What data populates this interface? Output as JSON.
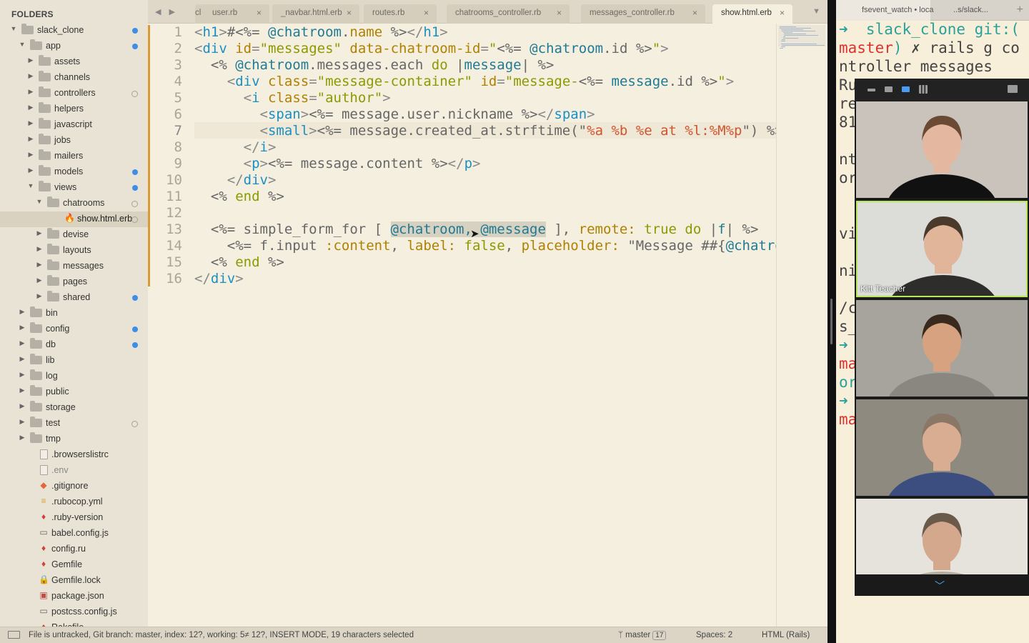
{
  "sidebar": {
    "title": "FOLDERS",
    "items": [
      {
        "label": "slack_clone",
        "type": "folder",
        "open": true,
        "depth": 0,
        "dot": "blue"
      },
      {
        "label": "app",
        "type": "folder",
        "open": true,
        "depth": 1,
        "dot": "blue"
      },
      {
        "label": "assets",
        "type": "folder",
        "open": false,
        "depth": 2,
        "dot": ""
      },
      {
        "label": "channels",
        "type": "folder",
        "open": false,
        "depth": 2,
        "dot": ""
      },
      {
        "label": "controllers",
        "type": "folder",
        "open": false,
        "depth": 2,
        "dot": "hollow"
      },
      {
        "label": "helpers",
        "type": "folder",
        "open": false,
        "depth": 2,
        "dot": ""
      },
      {
        "label": "javascript",
        "type": "folder",
        "open": false,
        "depth": 2,
        "dot": ""
      },
      {
        "label": "jobs",
        "type": "folder",
        "open": false,
        "depth": 2,
        "dot": ""
      },
      {
        "label": "mailers",
        "type": "folder",
        "open": false,
        "depth": 2,
        "dot": ""
      },
      {
        "label": "models",
        "type": "folder",
        "open": false,
        "depth": 2,
        "dot": "blue"
      },
      {
        "label": "views",
        "type": "folder",
        "open": true,
        "depth": 2,
        "dot": "blue"
      },
      {
        "label": "chatrooms",
        "type": "folder",
        "open": true,
        "depth": 3,
        "dot": "hollow"
      },
      {
        "label": "show.html.erb",
        "type": "file",
        "icon": "erb",
        "depth": 4,
        "dot": "hollow",
        "selected": true
      },
      {
        "label": "devise",
        "type": "folder",
        "open": false,
        "depth": 3,
        "dot": ""
      },
      {
        "label": "layouts",
        "type": "folder",
        "open": false,
        "depth": 3,
        "dot": ""
      },
      {
        "label": "messages",
        "type": "folder",
        "open": false,
        "depth": 3,
        "dot": ""
      },
      {
        "label": "pages",
        "type": "folder",
        "open": false,
        "depth": 3,
        "dot": ""
      },
      {
        "label": "shared",
        "type": "folder",
        "open": false,
        "depth": 3,
        "dot": "blue"
      },
      {
        "label": "bin",
        "type": "folder",
        "open": false,
        "depth": 1,
        "dot": ""
      },
      {
        "label": "config",
        "type": "folder",
        "open": false,
        "depth": 1,
        "dot": "blue"
      },
      {
        "label": "db",
        "type": "folder",
        "open": false,
        "depth": 1,
        "dot": "blue"
      },
      {
        "label": "lib",
        "type": "folder",
        "open": false,
        "depth": 1,
        "dot": ""
      },
      {
        "label": "log",
        "type": "folder",
        "open": false,
        "depth": 1,
        "dot": ""
      },
      {
        "label": "public",
        "type": "folder",
        "open": false,
        "depth": 1,
        "dot": ""
      },
      {
        "label": "storage",
        "type": "folder",
        "open": false,
        "depth": 1,
        "dot": ""
      },
      {
        "label": "test",
        "type": "folder",
        "open": false,
        "depth": 1,
        "dot": "hollow"
      },
      {
        "label": "tmp",
        "type": "folder",
        "open": false,
        "depth": 1,
        "dot": ""
      },
      {
        "label": ".browserslistrc",
        "type": "file",
        "icon": "plain",
        "depth": 1,
        "dot": ""
      },
      {
        "label": ".env",
        "type": "file",
        "icon": "plain",
        "depth": 1,
        "dot": "",
        "muted": true
      },
      {
        "label": ".gitignore",
        "type": "file",
        "icon": "git",
        "depth": 1,
        "dot": ""
      },
      {
        "label": ".rubocop.yml",
        "type": "file",
        "icon": "yml",
        "depth": 1,
        "dot": ""
      },
      {
        "label": ".ruby-version",
        "type": "file",
        "icon": "ruby",
        "depth": 1,
        "dot": ""
      },
      {
        "label": "babel.config.js",
        "type": "file",
        "icon": "js",
        "depth": 1,
        "dot": ""
      },
      {
        "label": "config.ru",
        "type": "file",
        "icon": "ruby",
        "depth": 1,
        "dot": ""
      },
      {
        "label": "Gemfile",
        "type": "file",
        "icon": "ruby",
        "depth": 1,
        "dot": ""
      },
      {
        "label": "Gemfile.lock",
        "type": "file",
        "icon": "lock",
        "depth": 1,
        "dot": ""
      },
      {
        "label": "package.json",
        "type": "file",
        "icon": "json",
        "depth": 1,
        "dot": ""
      },
      {
        "label": "postcss.config.js",
        "type": "file",
        "icon": "js",
        "depth": 1,
        "dot": ""
      },
      {
        "label": "Rakefile",
        "type": "file",
        "icon": "ruby",
        "depth": 1,
        "dot": ""
      }
    ]
  },
  "tabs": {
    "items": [
      {
        "label": "cl",
        "close": ""
      },
      {
        "label": "user.rb",
        "close": "×"
      },
      {
        "label": "_navbar.html.erb",
        "close": "×"
      },
      {
        "label": "routes.rb",
        "close": "×"
      },
      {
        "label": "chatrooms_controller.rb",
        "close": "×"
      },
      {
        "label": "messages_controller.rb",
        "close": "×"
      },
      {
        "label": "show.html.erb",
        "close": "×",
        "active": true
      }
    ],
    "nav": "◀ ▶",
    "menu": "▼"
  },
  "editor": {
    "current_line": 7,
    "line_numbers": [
      "1",
      "2",
      "3",
      "4",
      "5",
      "6",
      "7",
      "8",
      "9",
      "10",
      "11",
      "12",
      "13",
      "14",
      "15",
      "16"
    ]
  },
  "code": [
    [
      [
        "t-punc",
        "<"
      ],
      [
        "t-tag",
        "h1"
      ],
      [
        "t-punc",
        ">"
      ],
      [
        "t-erb",
        "#<%= "
      ],
      [
        "t-ivar",
        "@chatroom"
      ],
      [
        "t-erb",
        "."
      ],
      [
        "t-attr",
        "name"
      ],
      [
        "t-erb",
        " %>"
      ],
      [
        "t-punc",
        "</"
      ],
      [
        "t-tag",
        "h1"
      ],
      [
        "t-punc",
        ">"
      ]
    ],
    [
      [
        "t-punc",
        "<"
      ],
      [
        "t-tag",
        "div"
      ],
      [
        "t-erb",
        " "
      ],
      [
        "t-attr",
        "id"
      ],
      [
        "t-punc",
        "="
      ],
      [
        "t-str",
        "\"messages\""
      ],
      [
        "t-erb",
        " "
      ],
      [
        "t-attr",
        "data-chatroom-id"
      ],
      [
        "t-punc",
        "="
      ],
      [
        "t-str",
        "\""
      ],
      [
        "t-erb",
        "<%= "
      ],
      [
        "t-ivar",
        "@chatroom"
      ],
      [
        "t-erb",
        ".id %>"
      ],
      [
        "t-str",
        "\""
      ],
      [
        "t-punc",
        ">"
      ]
    ],
    [
      [
        "t-erb",
        "  <% "
      ],
      [
        "t-ivar",
        "@chatroom"
      ],
      [
        "t-erb",
        ".messages.each "
      ],
      [
        "t-kw",
        "do"
      ],
      [
        "t-erb",
        " |"
      ],
      [
        "t-ivar",
        "message"
      ],
      [
        "t-erb",
        "| %>"
      ]
    ],
    [
      [
        "t-erb",
        "    "
      ],
      [
        "t-punc",
        "<"
      ],
      [
        "t-tag",
        "div"
      ],
      [
        "t-erb",
        " "
      ],
      [
        "t-attr",
        "class"
      ],
      [
        "t-punc",
        "="
      ],
      [
        "t-str",
        "\"message-container\""
      ],
      [
        "t-erb",
        " "
      ],
      [
        "t-attr",
        "id"
      ],
      [
        "t-punc",
        "="
      ],
      [
        "t-str",
        "\"message-"
      ],
      [
        "t-erb",
        "<%= "
      ],
      [
        "t-ivar",
        "message"
      ],
      [
        "t-erb",
        ".id %>"
      ],
      [
        "t-str",
        "\""
      ],
      [
        "t-punc",
        ">"
      ]
    ],
    [
      [
        "t-erb",
        "      "
      ],
      [
        "t-punc",
        "<"
      ],
      [
        "t-tag",
        "i"
      ],
      [
        "t-erb",
        " "
      ],
      [
        "t-attr",
        "class"
      ],
      [
        "t-punc",
        "="
      ],
      [
        "t-str",
        "\"author\""
      ],
      [
        "t-punc",
        ">"
      ]
    ],
    [
      [
        "t-erb",
        "        "
      ],
      [
        "t-punc",
        "<"
      ],
      [
        "t-tag",
        "span"
      ],
      [
        "t-punc",
        ">"
      ],
      [
        "t-erb",
        "<%= message.user.nickname %>"
      ],
      [
        "t-punc",
        "</"
      ],
      [
        "t-tag",
        "span"
      ],
      [
        "t-punc",
        ">"
      ]
    ],
    [
      [
        "t-erb",
        "        "
      ],
      [
        "t-punc",
        "<"
      ],
      [
        "t-tag",
        "small"
      ],
      [
        "t-punc",
        ">"
      ],
      [
        "t-erb",
        "<%= message.created_at.strftime(\""
      ],
      [
        "t-fmt",
        "%a %b %e at %l:%M%p"
      ],
      [
        "t-erb",
        "\") %>"
      ]
    ],
    [
      [
        "t-erb",
        "      "
      ],
      [
        "t-punc",
        "</"
      ],
      [
        "t-tag",
        "i"
      ],
      [
        "t-punc",
        ">"
      ]
    ],
    [
      [
        "t-erb",
        "      "
      ],
      [
        "t-punc",
        "<"
      ],
      [
        "t-tag",
        "p"
      ],
      [
        "t-punc",
        ">"
      ],
      [
        "t-erb",
        "<%= message.content %>"
      ],
      [
        "t-punc",
        "</"
      ],
      [
        "t-tag",
        "p"
      ],
      [
        "t-punc",
        ">"
      ]
    ],
    [
      [
        "t-erb",
        "    "
      ],
      [
        "t-punc",
        "</"
      ],
      [
        "t-tag",
        "div"
      ],
      [
        "t-punc",
        ">"
      ]
    ],
    [
      [
        "t-erb",
        "  <% "
      ],
      [
        "t-kw",
        "end"
      ],
      [
        "t-erb",
        " %>"
      ]
    ],
    [
      [
        "t-erb",
        ""
      ]
    ],
    [
      [
        "t-erb",
        "  <%= simple_form_for [ "
      ],
      [
        "t-ivar sel",
        "@chatroom, @message"
      ],
      [
        "t-erb",
        " ], "
      ],
      [
        "t-sym",
        "remote:"
      ],
      [
        "t-erb",
        " "
      ],
      [
        "t-kw",
        "true"
      ],
      [
        "t-erb",
        " "
      ],
      [
        "t-kw",
        "do"
      ],
      [
        "t-erb",
        " |"
      ],
      [
        "t-ivar",
        "f"
      ],
      [
        "t-erb",
        "| %>"
      ]
    ],
    [
      [
        "t-erb",
        "    <%= f.input "
      ],
      [
        "t-sym",
        ":content"
      ],
      [
        "t-erb",
        ", "
      ],
      [
        "t-sym",
        "label:"
      ],
      [
        "t-erb",
        " "
      ],
      [
        "t-kw",
        "false"
      ],
      [
        "t-erb",
        ", "
      ],
      [
        "t-sym",
        "placeholder:"
      ],
      [
        "t-erb",
        " \"Message ##{"
      ],
      [
        "t-ivar",
        "@chatroom.name"
      ],
      [
        "t-erb",
        "}\" %>"
      ]
    ],
    [
      [
        "t-erb",
        "  <% "
      ],
      [
        "t-kw",
        "end"
      ],
      [
        "t-erb",
        " %>"
      ]
    ],
    [
      [
        "t-punc",
        "</"
      ],
      [
        "t-tag",
        "div"
      ],
      [
        "t-punc",
        ">"
      ]
    ]
  ],
  "statusbar": {
    "message": "File is untracked, Git branch: master, index: 12?, working: 5≠ 12?, INSERT MODE, 19 characters selected",
    "branch": "master",
    "branch_count": "17",
    "spaces": "Spaces: 2",
    "syntax": "HTML (Rails)"
  },
  "terminal": {
    "tabs": [
      {
        "label": "fsevent_watch • loca",
        "active": true
      },
      {
        "label": "..s/slack...",
        "active": false
      }
    ],
    "plus": "+",
    "lines": [
      [
        [
          "tc-green",
          "➜  slack_clone "
        ],
        [
          "tc-green",
          "git:("
        ]
      ],
      [
        [
          "tc-red",
          "master"
        ],
        [
          "tc-green",
          ")"
        ],
        [
          "tc-dark",
          " ✗ rails g co"
        ]
      ],
      [
        [
          "tc-dark",
          "ntroller messages"
        ]
      ],
      [
        [
          "tc-dark",
          "Ru"
        ]
      ],
      [
        [
          "tc-dark",
          "re"
        ]
      ],
      [
        [
          "tc-dark",
          "81"
        ]
      ],
      [
        [
          "tc-dark",
          ""
        ]
      ],
      [
        [
          "tc-dark",
          "nt"
        ]
      ],
      [
        [
          "tc-dark",
          "or"
        ]
      ],
      [
        [
          "tc-dark",
          ""
        ]
      ],
      [
        [
          "tc-dark",
          ""
        ]
      ],
      [
        [
          "tc-dark",
          "vi"
        ]
      ],
      [
        [
          "tc-dark",
          ""
        ]
      ],
      [
        [
          "tc-dark",
          "ni"
        ]
      ],
      [
        [
          "tc-dark",
          ""
        ]
      ],
      [
        [
          "tc-dark",
          "/c"
        ]
      ],
      [
        [
          "tc-dark",
          "s_"
        ]
      ],
      [
        [
          "tc-green",
          "➜"
        ]
      ],
      [
        [
          "tc-red",
          "ma"
        ]
      ],
      [
        [
          "tc-green",
          "or"
        ]
      ],
      [
        [
          "tc-green",
          "➜"
        ]
      ],
      [
        [
          "tc-red",
          "ma"
        ]
      ]
    ]
  },
  "video_call": {
    "participants": [
      {
        "name": "",
        "speaking": false,
        "bg": "#c9c3bb",
        "shirt": "#111111",
        "skin": "#e4b7a0",
        "hair": "#6b4a35"
      },
      {
        "name": "Kitt Teacher",
        "speaking": true,
        "bg": "#dcdcd8",
        "shirt": "#2e2d2c",
        "skin": "#e0b59a",
        "hair": "#4a3a2c"
      },
      {
        "name": "",
        "speaking": false,
        "bg": "#a7a49e",
        "shirt": "#8a8680",
        "skin": "#d6a27f",
        "hair": "#3a2a1e"
      },
      {
        "name": "",
        "speaking": false,
        "bg": "#8f8a80",
        "shirt": "#3c4d80",
        "skin": "#d9ad92",
        "hair": "#8a7765"
      },
      {
        "name": "",
        "speaking": false,
        "bg": "#e6e3dc",
        "shirt": "#b5aca0",
        "skin": "#d4a88d",
        "hair": "#6a5a4a"
      }
    ]
  }
}
